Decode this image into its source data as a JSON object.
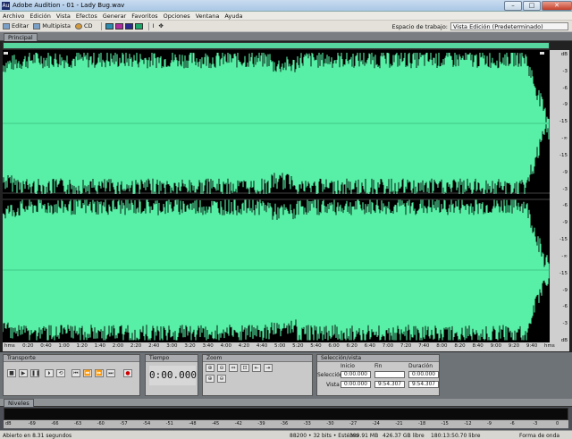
{
  "window": {
    "title": "Adobe Audition - 01 - Lady Bug.wav",
    "app_icon": "Au"
  },
  "menu": [
    "Archivo",
    "Edición",
    "Vista",
    "Efectos",
    "Generar",
    "Favoritos",
    "Opciones",
    "Ventana",
    "Ayuda"
  ],
  "toolbar": {
    "edit_label": "Editar",
    "multitrack_label": "Multipista",
    "cd_label": "CD",
    "workspace_label": "Espacio de trabajo:",
    "workspace_value": "Vista Edición (Predeterminado)"
  },
  "main_panel": {
    "tab_label": "Principal"
  },
  "db_scale": [
    "dB",
    "-3",
    "-6",
    "-9",
    "-15",
    "-∞",
    "-15",
    "-9",
    "-3",
    "-6",
    "-9",
    "-15",
    "-∞",
    "-15",
    "-9",
    "-6",
    "-3",
    "dB"
  ],
  "time_ruler": [
    "hms",
    "0:20",
    "0:40",
    "1:00",
    "1:20",
    "1:40",
    "2:00",
    "2:20",
    "2:40",
    "3:00",
    "3:20",
    "3:40",
    "4:00",
    "4:20",
    "4:40",
    "5:00",
    "5:20",
    "5:40",
    "6:00",
    "6:20",
    "6:40",
    "7:00",
    "7:20",
    "7:40",
    "8:00",
    "8:20",
    "8:40",
    "9:00",
    "9:20",
    "9:40",
    "hms"
  ],
  "transport": {
    "tab_label": "Transporte"
  },
  "time": {
    "tab_label": "Tiempo",
    "value": "0:00.000"
  },
  "zoom": {
    "tab_label": "Zoom"
  },
  "selection": {
    "tab_label": "Selección/vista",
    "headers": [
      "Inicio",
      "Fin",
      "Duración"
    ],
    "rows": [
      {
        "label": "Selección",
        "values": [
          "0:00.000",
          "",
          "0:00.000"
        ]
      },
      {
        "label": "Vista",
        "values": [
          "0:00.000",
          "9:54.307",
          "9:54.307"
        ]
      }
    ]
  },
  "levels": {
    "tab_label": "Niveles",
    "scale": [
      "dB",
      "-69",
      "-66",
      "-63",
      "-60",
      "-57",
      "-54",
      "-51",
      "-48",
      "-45",
      "-42",
      "-39",
      "-36",
      "-33",
      "-30",
      "-27",
      "-24",
      "-21",
      "-18",
      "-15",
      "-12",
      "-9",
      "-6",
      "-3",
      "0"
    ]
  },
  "status": {
    "left": "Abierto en 8.31 segundos",
    "format": "88200 • 32 bits • Estéreo",
    "size": "399.91 MB",
    "free": "426.37 GB libre",
    "time_free": "180:13:50.70 libre",
    "view": "Forma de onda"
  },
  "colors": {
    "waveform": "#58f0a6",
    "background": "#000000"
  }
}
